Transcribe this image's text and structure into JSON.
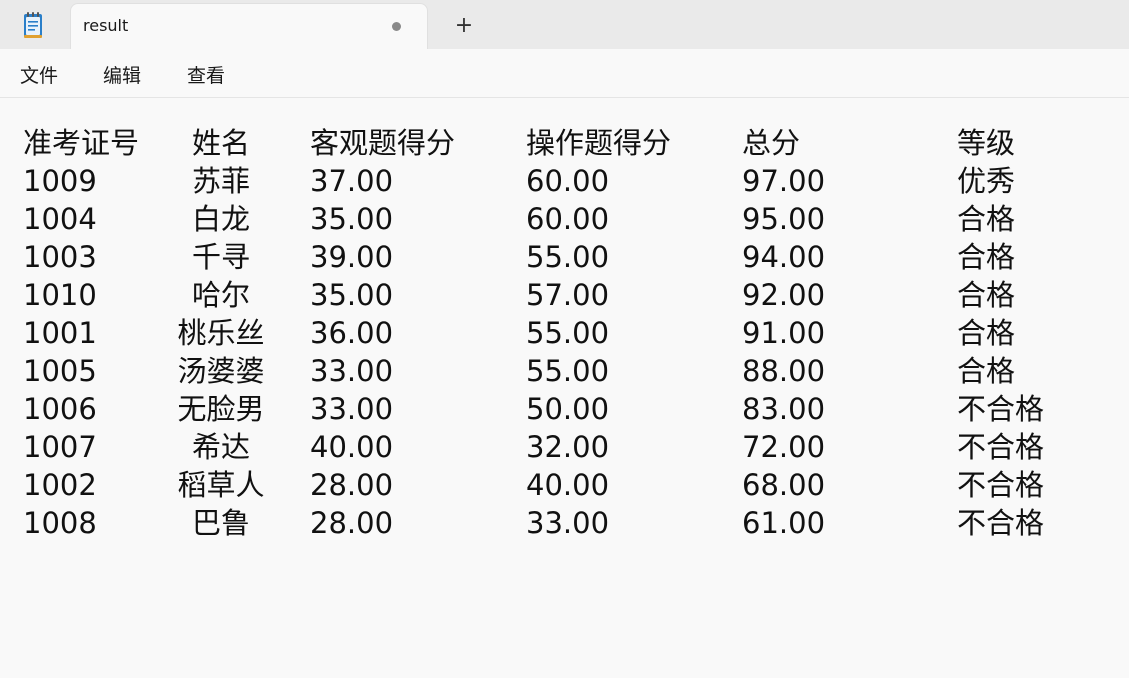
{
  "tab": {
    "title": "result"
  },
  "new_tab_label": "+",
  "menu": {
    "file": "文件",
    "edit": "编辑",
    "view": "查看"
  },
  "table": {
    "headers": [
      "准考证号",
      "姓名",
      "客观题得分",
      "操作题得分",
      "总分",
      "等级"
    ],
    "rows": [
      [
        "1009",
        "苏菲",
        "37.00",
        "60.00",
        "97.00",
        "优秀"
      ],
      [
        "1004",
        "白龙",
        "35.00",
        "60.00",
        "95.00",
        "合格"
      ],
      [
        "1003",
        "千寻",
        "39.00",
        "55.00",
        "94.00",
        "合格"
      ],
      [
        "1010",
        "哈尔",
        "35.00",
        "57.00",
        "92.00",
        "合格"
      ],
      [
        "1001",
        "桃乐丝",
        "36.00",
        "55.00",
        "91.00",
        "合格"
      ],
      [
        "1005",
        "汤婆婆",
        "33.00",
        "55.00",
        "88.00",
        "合格"
      ],
      [
        "1006",
        "无脸男",
        "33.00",
        "50.00",
        "83.00",
        "不合格"
      ],
      [
        "1007",
        "希达",
        "40.00",
        "32.00",
        "72.00",
        "不合格"
      ],
      [
        "1002",
        "稻草人",
        "28.00",
        "40.00",
        "68.00",
        "不合格"
      ],
      [
        "1008",
        "巴鲁",
        "28.00",
        "33.00",
        "61.00",
        "不合格"
      ]
    ]
  }
}
